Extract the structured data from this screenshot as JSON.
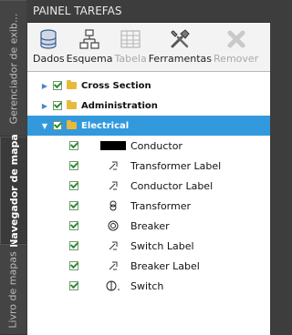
{
  "sidetabs": [
    "Gerenciador de exib...",
    "Navegador de mapa",
    "Livro de mapas"
  ],
  "title": "PAINEL TAREFAS",
  "toolbar": [
    {
      "label": "Dados",
      "icon": "database-icon",
      "enabled": true
    },
    {
      "label": "Esquema",
      "icon": "schema-icon",
      "enabled": true
    },
    {
      "label": "Tabela",
      "icon": "table-icon",
      "enabled": false
    },
    {
      "label": "Ferramentas",
      "icon": "tools-icon",
      "enabled": true
    },
    {
      "label": "Remover",
      "icon": "remove-icon",
      "enabled": false
    }
  ],
  "groups": [
    {
      "label": "Cross Section",
      "expanded": false
    },
    {
      "label": "Administration",
      "expanded": false
    },
    {
      "label": "Electrical",
      "expanded": true
    }
  ],
  "layers": [
    {
      "label": "Conductor",
      "symbol": "black-bar"
    },
    {
      "label": "Transformer Label",
      "symbol": "label-symbol"
    },
    {
      "label": "Conductor Label",
      "symbol": "label-symbol"
    },
    {
      "label": "Transformer",
      "symbol": "transformer-symbol"
    },
    {
      "label": "Breaker",
      "symbol": "breaker-symbol"
    },
    {
      "label": "Switch Label",
      "symbol": "label-symbol"
    },
    {
      "label": "Breaker Label",
      "symbol": "label-symbol"
    },
    {
      "label": "Switch",
      "symbol": "switch-symbol"
    }
  ],
  "colors": {
    "selection": "#3399dd",
    "check": "#2e8b2e",
    "folder": "#e8b93a"
  }
}
